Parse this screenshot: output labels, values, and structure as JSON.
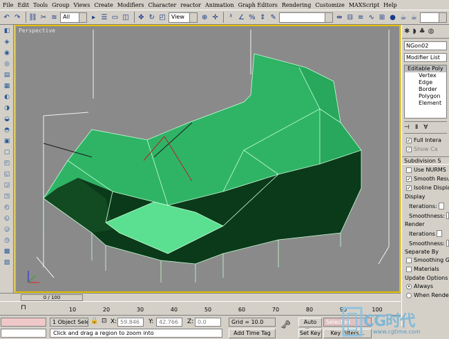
{
  "menu": [
    "File",
    "Edit",
    "Tools",
    "Group",
    "Views",
    "Create",
    "Modifiers",
    "Character",
    "reactor",
    "Animation",
    "Graph Editors",
    "Rendering",
    "Customize",
    "MAXScript",
    "Help"
  ],
  "toolbar": {
    "filter_value": "All",
    "refcoord_value": "View"
  },
  "viewport": {
    "label": "Perspective"
  },
  "command_panel": {
    "object_name": "NGon02",
    "modifier_list": "Modifier List",
    "stack_top": "Editable Poly",
    "stack_items": [
      "Vertex",
      "Edge",
      "Border",
      "Polygon",
      "Element"
    ],
    "full_interactivity": "Full Intera",
    "show_cage": "Show Ca",
    "subdivision_rollout": "Subdivision S",
    "use_nurms": "Use NURMS",
    "smooth_result": "Smooth Resul",
    "isoline_display": "Isoline Display",
    "display_group": "Display",
    "iterations_label": "Iterations:",
    "smoothness_label": "Smoothness:",
    "render_group": "Render",
    "iterations_label2": "Iterations",
    "smoothness_label2": "Smoothness:",
    "separate_by": "Separate By",
    "smoothing_groups": "Smoothing Gro",
    "materials": "Materials",
    "update_options": "Update Options",
    "always": "Always",
    "when_rendering": "When Render"
  },
  "timeline": {
    "slider_text": "0 / 100",
    "ticks": [
      "10",
      "20",
      "30",
      "40",
      "50",
      "60",
      "70",
      "80",
      "90",
      "100"
    ]
  },
  "status": {
    "selection": "1 Object Sele",
    "x_label": "X:",
    "x_value": "59.846",
    "y_label": "Y:",
    "y_value": "42.766",
    "z_label": "Z:",
    "z_value": "0.0",
    "grid": "Grid = 10.0",
    "prompt": "Click and drag a region to zoom into",
    "add_time_tag": "Add Time Tag",
    "auto_key": "Auto Key",
    "set_key": "Set Key",
    "selected": "Selected",
    "key_filters": "Key Filters..."
  },
  "watermark": {
    "brand": "CG时代",
    "url": "www.cgtime.com"
  },
  "colors": {
    "viewport_border": "#e6c200",
    "mesh_light": "#33b86a",
    "mesh_dark": "#0a3a18",
    "mesh_highlight": "#5ae090"
  }
}
